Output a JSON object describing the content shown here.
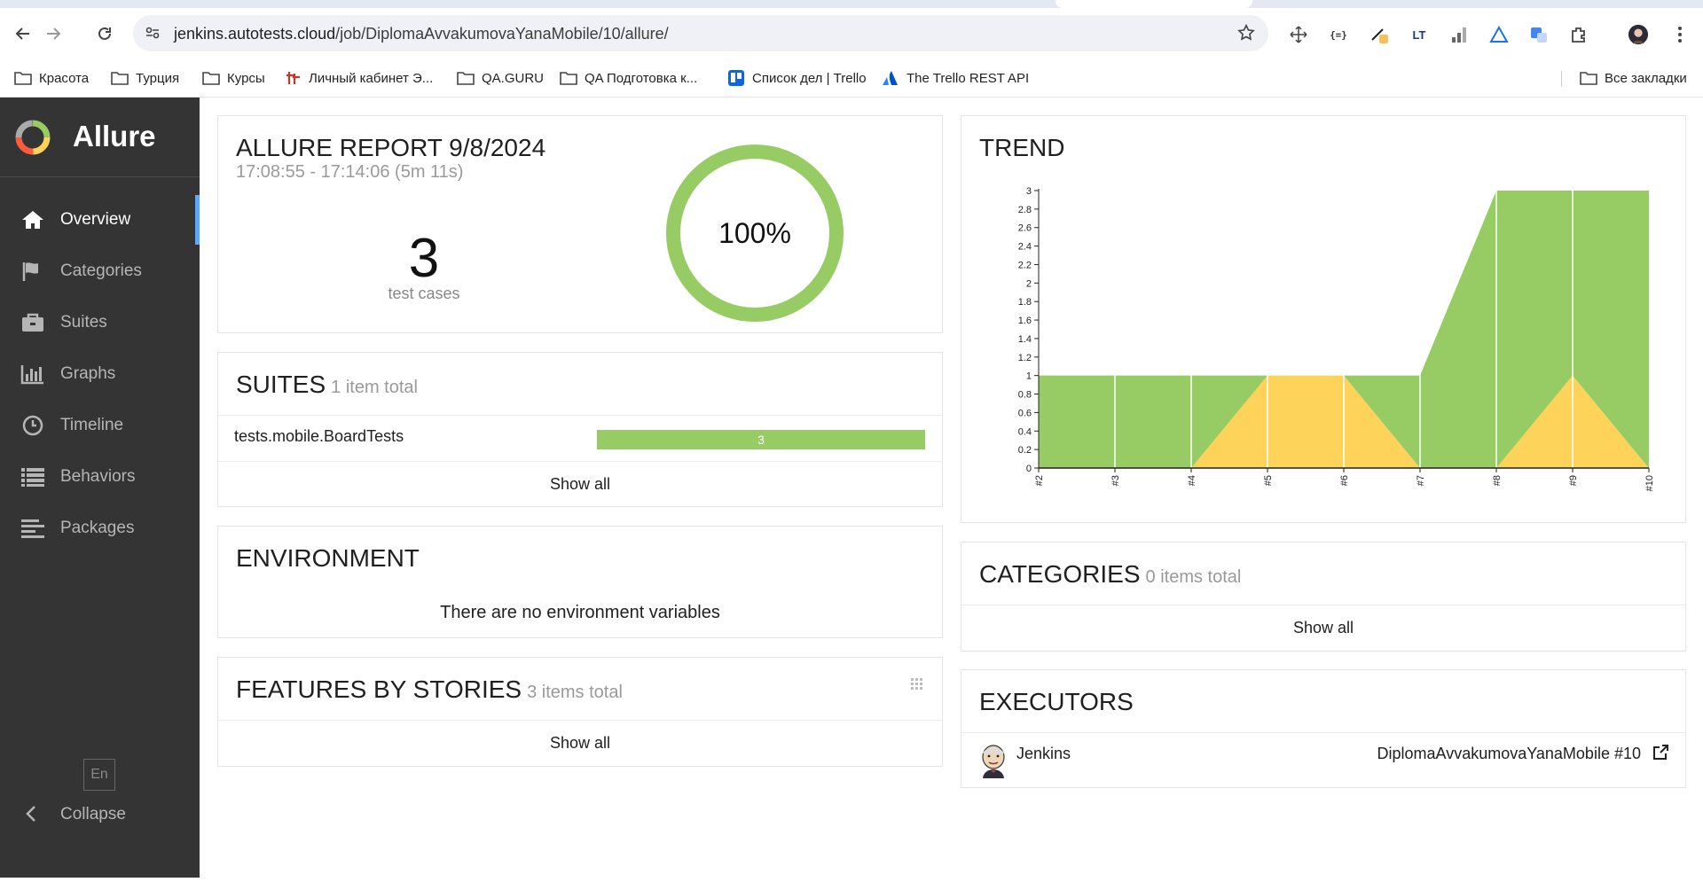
{
  "browser": {
    "url_domain": "jenkins.autotests.cloud",
    "url_path": "/job/DiplomaAvvakumovaYanaMobile/10/allure/",
    "bookmarks": [
      {
        "label": "Красота",
        "icon": "folder-icon"
      },
      {
        "label": "Турция",
        "icon": "folder-icon"
      },
      {
        "label": "Курсы",
        "icon": "folder-icon"
      },
      {
        "label": "Личный кабинет Э...",
        "icon": "site-icon"
      },
      {
        "label": "QA.GURU",
        "icon": "folder-icon"
      },
      {
        "label": "QA Подготовка к...",
        "icon": "folder-icon"
      },
      {
        "label": "Список дел | Trello",
        "icon": "trello-icon"
      },
      {
        "label": "The Trello REST API",
        "icon": "atlassian-icon"
      }
    ],
    "all_bookmarks": "Все закладки"
  },
  "app": {
    "brand": "Allure",
    "nav": [
      {
        "label": "Overview",
        "icon": "home-icon",
        "active": true
      },
      {
        "label": "Categories",
        "icon": "flag-icon"
      },
      {
        "label": "Suites",
        "icon": "briefcase-icon"
      },
      {
        "label": "Graphs",
        "icon": "bar-chart-icon"
      },
      {
        "label": "Timeline",
        "icon": "clock-icon"
      },
      {
        "label": "Behaviors",
        "icon": "list-icon"
      },
      {
        "label": "Packages",
        "icon": "align-left-icon"
      }
    ],
    "lang": "En",
    "collapse": "Collapse"
  },
  "summary": {
    "title": "ALLURE REPORT 9/8/2024",
    "time_range": "17:08:55 - 17:14:06 (5m 11s)",
    "test_cases": "3",
    "test_cases_label": "test cases",
    "success_rate": "100%",
    "success_fraction": 1.0
  },
  "suites": {
    "title": "SUITES",
    "count": "1 item total",
    "rows": [
      {
        "name": "tests.mobile.BoardTests",
        "passed": "3",
        "passed_fraction": 1.0
      }
    ],
    "show_all": "Show all"
  },
  "environment": {
    "title": "ENVIRONMENT",
    "message": "There are no environment variables"
  },
  "features": {
    "title": "FEATURES BY STORIES",
    "count": "3 items total",
    "show_all": "Show all"
  },
  "trend": {
    "title": "TREND"
  },
  "categories": {
    "title": "CATEGORIES",
    "count": "0 items total",
    "show_all": "Show all"
  },
  "executors": {
    "title": "EXECUTORS",
    "name": "Jenkins",
    "build": "DiplomaAvvakumovaYanaMobile #10"
  },
  "colors": {
    "passed": "#97cc64",
    "failed": "#fdd35a",
    "sidebar": "#343434",
    "active_accent": "#5ea7ff"
  },
  "chart_data": {
    "type": "area",
    "title": "TREND",
    "x": [
      "#2",
      "#3",
      "#4",
      "#5",
      "#6",
      "#7",
      "#8",
      "#9",
      "#10"
    ],
    "ylim": [
      0,
      3
    ],
    "yticks": [
      "0",
      "0.2",
      "0.4",
      "0.6",
      "0.8",
      "1",
      "1.2",
      "1.4",
      "1.6",
      "1.8",
      "2",
      "2.2",
      "2.4",
      "2.6",
      "2.8",
      "3"
    ],
    "series": [
      {
        "status": "failed",
        "color": "#fdd35a",
        "values": [
          0,
          0,
          0,
          1,
          1,
          0,
          0,
          1,
          0
        ]
      },
      {
        "status": "passed",
        "color": "#97cc64",
        "values": [
          1,
          1,
          1,
          0,
          0,
          1,
          3,
          2,
          3
        ]
      }
    ],
    "stacked": true,
    "grid": false
  }
}
